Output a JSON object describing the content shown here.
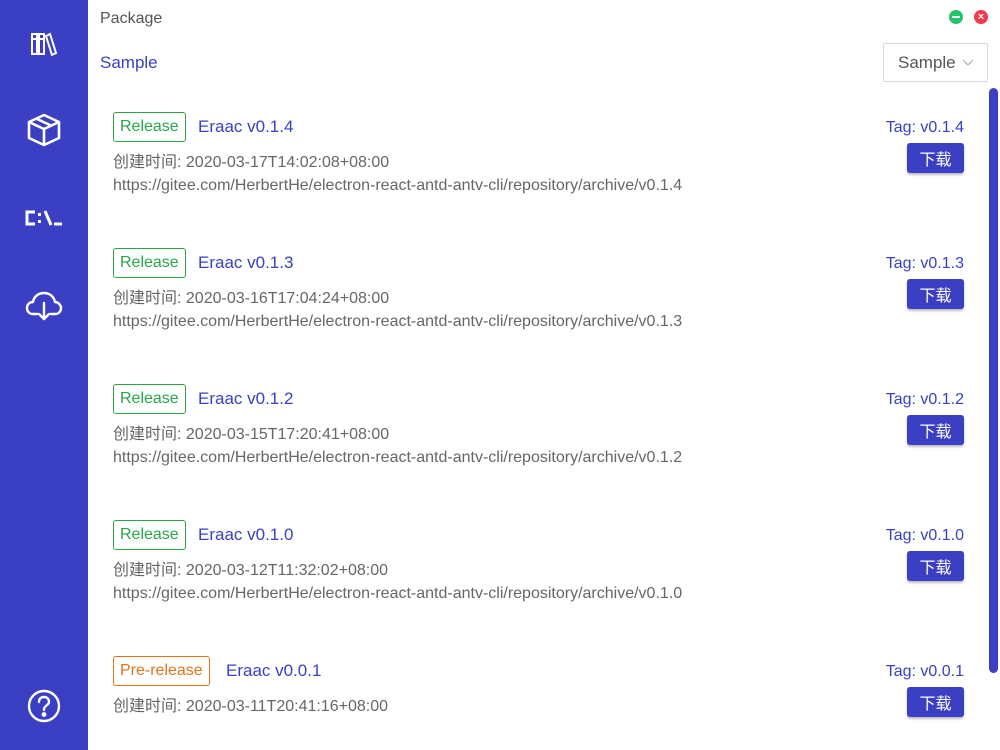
{
  "window": {
    "title": "Package"
  },
  "sidebar": {
    "items": [
      {
        "name": "library",
        "icon": "books-icon"
      },
      {
        "name": "package",
        "icon": "box-icon"
      },
      {
        "name": "console",
        "icon": "terminal-icon"
      },
      {
        "name": "cloud-download",
        "icon": "cloud-download-icon"
      }
    ],
    "help_icon": "help-icon"
  },
  "header": {
    "breadcrumb": "Sample",
    "select_value": "Sample"
  },
  "releases": [
    {
      "type": "Release",
      "name": "Eraac v0.1.4",
      "created": "创建时间: 2020-03-17T14:02:08+08:00",
      "url": "https://gitee.com/HerbertHe/electron-react-antd-antv-cli/repository/archive/v0.1.4",
      "tag": "Tag: v0.1.4",
      "download_label": "下载"
    },
    {
      "type": "Release",
      "name": "Eraac v0.1.3",
      "created": "创建时间: 2020-03-16T17:04:24+08:00",
      "url": "https://gitee.com/HerbertHe/electron-react-antd-antv-cli/repository/archive/v0.1.3",
      "tag": "Tag: v0.1.3",
      "download_label": "下载"
    },
    {
      "type": "Release",
      "name": "Eraac v0.1.2",
      "created": "创建时间: 2020-03-15T17:20:41+08:00",
      "url": "https://gitee.com/HerbertHe/electron-react-antd-antv-cli/repository/archive/v0.1.2",
      "tag": "Tag: v0.1.2",
      "download_label": "下载"
    },
    {
      "type": "Release",
      "name": "Eraac v0.1.0",
      "created": "创建时间: 2020-03-12T11:32:02+08:00",
      "url": "https://gitee.com/HerbertHe/electron-react-antd-antv-cli/repository/archive/v0.1.0",
      "tag": "Tag: v0.1.0",
      "download_label": "下载"
    },
    {
      "type": "Pre-release",
      "name": "Eraac v0.0.1",
      "created": "创建时间: 2020-03-11T20:41:16+08:00",
      "url": "",
      "tag": "Tag: v0.0.1",
      "download_label": "下载"
    }
  ],
  "colors": {
    "accent": "#3a3fc4",
    "release": "#2aa54a",
    "prerelease": "#e37318",
    "minimize": "#22c36a",
    "close": "#f5394c"
  }
}
